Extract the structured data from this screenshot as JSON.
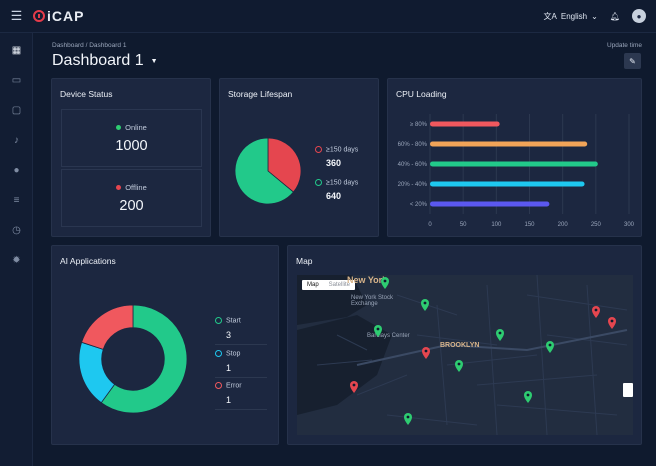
{
  "app": {
    "name": "iCAP"
  },
  "topbar": {
    "language": "English"
  },
  "breadcrumb": "Dashboard / Dashboard 1",
  "page_title": "Dashboard 1",
  "update_time_label": "Update time",
  "device_status": {
    "title": "Device Status",
    "online_label": "Online",
    "online_value": "1000",
    "offline_label": "Offline",
    "offline_value": "200",
    "colors": {
      "online": "#2ecc71",
      "offline": "#e5464f"
    }
  },
  "storage": {
    "title": "Storage Lifespan",
    "legend": [
      {
        "label": "≥150 days",
        "value": "360",
        "color": "#e5464f"
      },
      {
        "label": "≥150 days",
        "value": "640",
        "color": "#22c98a"
      }
    ]
  },
  "cpu": {
    "title": "CPU Loading"
  },
  "ai": {
    "title": "AI Applications",
    "legend": [
      {
        "label": "Start",
        "value": "3",
        "color": "#22c98a"
      },
      {
        "label": "Stop",
        "value": "1",
        "color": "#1ec8f0"
      },
      {
        "label": "Error",
        "value": "1",
        "color": "#f0585e"
      }
    ]
  },
  "map": {
    "title": "Map",
    "toggle_map": "Map",
    "toggle_satellite": "Satellite",
    "labels": {
      "city": "New York",
      "brooklyn": "BROOKLYN",
      "stock_exchange": "New York Stock Exchange",
      "barclays": "Barclays Center"
    }
  },
  "chart_data": [
    {
      "type": "bar",
      "title": "CPU Loading",
      "orientation": "horizontal",
      "categories": [
        "≥ 80%",
        "60% - 80%",
        "40% - 60%",
        "20% - 40%",
        "< 20%"
      ],
      "values": [
        105,
        237,
        253,
        233,
        180
      ],
      "colors": [
        "#f0585e",
        "#f1a458",
        "#22c98a",
        "#1ec8f0",
        "#5b58f0"
      ],
      "xlim": [
        0,
        300
      ],
      "xticks": [
        "0",
        "50",
        "100",
        "150",
        "200",
        "250",
        "300"
      ],
      "grid": true
    },
    {
      "type": "pie",
      "title": "Storage Lifespan",
      "labels": [
        "≥150 days",
        "≥150 days"
      ],
      "values": [
        360,
        640
      ],
      "colors": [
        "#e5464f",
        "#22c98a"
      ]
    },
    {
      "type": "pie",
      "title": "AI Applications",
      "style": "donut",
      "labels": [
        "Start",
        "Stop",
        "Error"
      ],
      "values": [
        3,
        1,
        1
      ],
      "colors": [
        "#22c98a",
        "#1ec8f0",
        "#f0585e"
      ]
    }
  ]
}
